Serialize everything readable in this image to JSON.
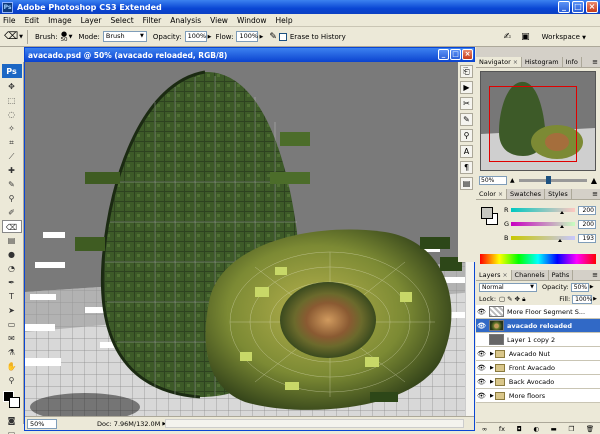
{
  "app": {
    "title": "Adobe Photoshop CS3 Extended",
    "logo_text": "Ps",
    "window_controls": [
      "minimize-icon",
      "maximize-icon",
      "close-icon"
    ]
  },
  "menu": [
    "File",
    "Edit",
    "Image",
    "Layer",
    "Select",
    "Filter",
    "Analysis",
    "View",
    "Window",
    "Help"
  ],
  "options": {
    "brush_label": "Brush:",
    "brush_size": "50",
    "mode_label": "Mode:",
    "mode_value": "Brush",
    "opacity_label": "Opacity:",
    "opacity_value": "100%",
    "flow_label": "Flow:",
    "flow_value": "100%",
    "erase_history_label": "Erase to History",
    "workspace_label": "Workspace"
  },
  "document": {
    "title": "avacado.psd @ 50% (avacado reloaded, RGB/8)",
    "zoom": "50%",
    "doc_info": "Doc: 7.96M/132.0M"
  },
  "navigator": {
    "tabs": [
      "Navigator",
      "Histogram",
      "Info"
    ],
    "zoom": "50%",
    "slider_fraction": 0.4
  },
  "color": {
    "tabs": [
      "Color",
      "Swatches",
      "Styles"
    ],
    "channels": [
      {
        "label": "R",
        "value": "200",
        "color": "#c8c8c1"
      },
      {
        "label": "G",
        "value": "200",
        "color": "#c8c8c1"
      },
      {
        "label": "B",
        "value": "193",
        "color": "#c8c8c1"
      }
    ],
    "fg_color": "#c8c8c1"
  },
  "layers": {
    "tabs": [
      "Layers",
      "Channels",
      "Paths"
    ],
    "blend_mode": "Normal",
    "opacity_label": "Opacity:",
    "opacity_value": "50%",
    "lock_label": "Lock:",
    "fill_label": "Fill:",
    "fill_value": "100%",
    "items": [
      {
        "name": "More Floor Segment S...",
        "type": "layer",
        "visible": true,
        "selected": false,
        "thumb": "checker"
      },
      {
        "name": "avacado reloaded",
        "type": "layer",
        "visible": true,
        "selected": true,
        "thumb": "avo"
      },
      {
        "name": "Layer 1 copy 2",
        "type": "layer",
        "visible": false,
        "selected": false,
        "thumb": "gray"
      },
      {
        "name": "Avacado Nut",
        "type": "group",
        "visible": true,
        "selected": false
      },
      {
        "name": "Front Avacado",
        "type": "group",
        "visible": true,
        "selected": false
      },
      {
        "name": "Back Avocado",
        "type": "group",
        "visible": true,
        "selected": false
      },
      {
        "name": "More floors",
        "type": "group",
        "visible": true,
        "selected": false
      }
    ]
  }
}
